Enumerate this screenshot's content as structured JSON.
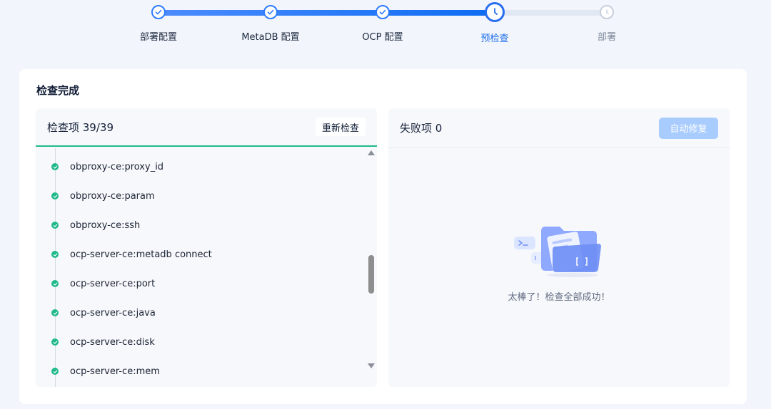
{
  "steps": [
    {
      "label": "部署配置",
      "state": "done"
    },
    {
      "label": "MetaDB 配置",
      "state": "done"
    },
    {
      "label": "OCP 配置",
      "state": "done"
    },
    {
      "label": "预检查",
      "state": "active"
    },
    {
      "label": "部署",
      "state": "todo"
    }
  ],
  "card": {
    "title": "检查完成"
  },
  "check_panel": {
    "title": "检查项 39/39",
    "recheck_label": "重新检查",
    "items": [
      "obproxy-ce:proxy_id",
      "obproxy-ce:param",
      "obproxy-ce:ssh",
      "ocp-server-ce:metadb connect",
      "ocp-server-ce:port",
      "ocp-server-ce:java",
      "ocp-server-ce:disk",
      "ocp-server-ce:mem"
    ]
  },
  "fail_panel": {
    "title": "失败项 0",
    "autofix_label": "自动修复",
    "empty_text": "太棒了！检查全部成功！"
  },
  "colors": {
    "primary": "#1f6feb",
    "success": "#1fb98a",
    "autofix_disabled": "#a9ccff"
  }
}
